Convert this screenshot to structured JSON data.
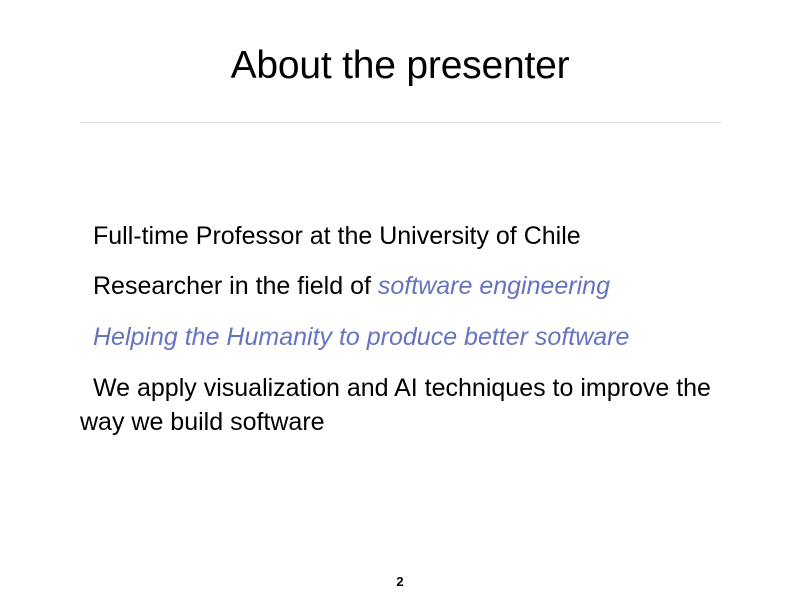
{
  "slide": {
    "title": "About the presenter",
    "lines": [
      {
        "text": "Full-time Professor at the University of Chile"
      },
      {
        "text": "Researcher in the field of ",
        "emphasis": "software engineering"
      },
      {
        "emphasis": "Helping the Humanity to produce better software"
      },
      {
        "text": "We apply visualization and AI techniques to improve the way we build software"
      }
    ],
    "page_number": "2"
  },
  "colors": {
    "accent": "#6673c0",
    "text": "#000000",
    "rule": "#dcdcdc"
  }
}
